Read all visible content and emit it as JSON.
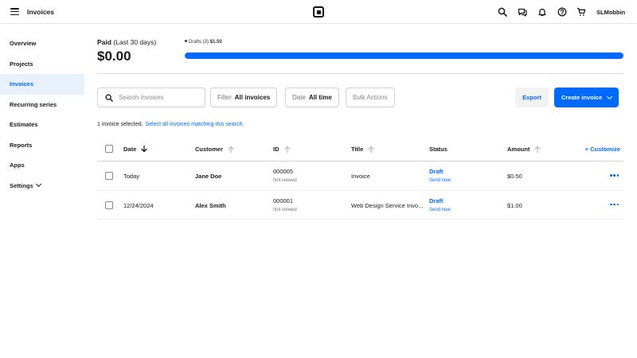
{
  "header": {
    "title": "Invoices",
    "user": "SLMobbin",
    "icons": [
      "search-icon",
      "chat-icon",
      "bell-icon",
      "help-icon",
      "cart-icon"
    ]
  },
  "sidebar": {
    "items": [
      {
        "label": "Overview",
        "active": false
      },
      {
        "label": "Projects",
        "active": false
      },
      {
        "label": "Invoices",
        "active": true
      },
      {
        "label": "Recurring series",
        "active": false
      },
      {
        "label": "Estimates",
        "active": false
      },
      {
        "label": "Reports",
        "active": false
      },
      {
        "label": "Apps",
        "active": false
      },
      {
        "label": "Settings",
        "active": false
      }
    ]
  },
  "summary": {
    "paid_label": "Paid",
    "paid_period": "(Last 30 days)",
    "paid_amount": "$0.00",
    "drafts_label": "Drafts (3)",
    "drafts_amount": "$1.50",
    "drafts_fraction": 1.0
  },
  "toolbar": {
    "search_placeholder": "Search invoices",
    "filter_label": "Filter",
    "filter_value": "All invoices",
    "date_label": "Date",
    "date_value": "All time",
    "bulk_actions": "Bulk Actions",
    "export": "Export",
    "create": "Create invoice"
  },
  "selection": {
    "text": "1 invoice selected.",
    "link": "Select all invoices matching this search."
  },
  "table": {
    "columns": {
      "date": "Date",
      "customer": "Customer",
      "id": "ID",
      "title": "Title",
      "status": "Status",
      "amount": "Amount",
      "customize": "+ Customize"
    },
    "rows": [
      {
        "date": "Today",
        "customer": "Jane Doe",
        "id": "000005",
        "id_sub": "Not viewed",
        "title": "Invoice",
        "status": "Draft",
        "status_sub": "Send now",
        "amount": "$0.50"
      },
      {
        "date": "12/24/2024",
        "customer": "Alex Smith",
        "id": "000001",
        "id_sub": "Not viewed",
        "title": "Web Design Service Invo...",
        "status": "Draft",
        "status_sub": "Send now",
        "amount": "$1.00"
      }
    ]
  },
  "colors": {
    "accent": "#006aff",
    "active_bg": "#e8f0fb",
    "track": "#e6e6e6"
  }
}
